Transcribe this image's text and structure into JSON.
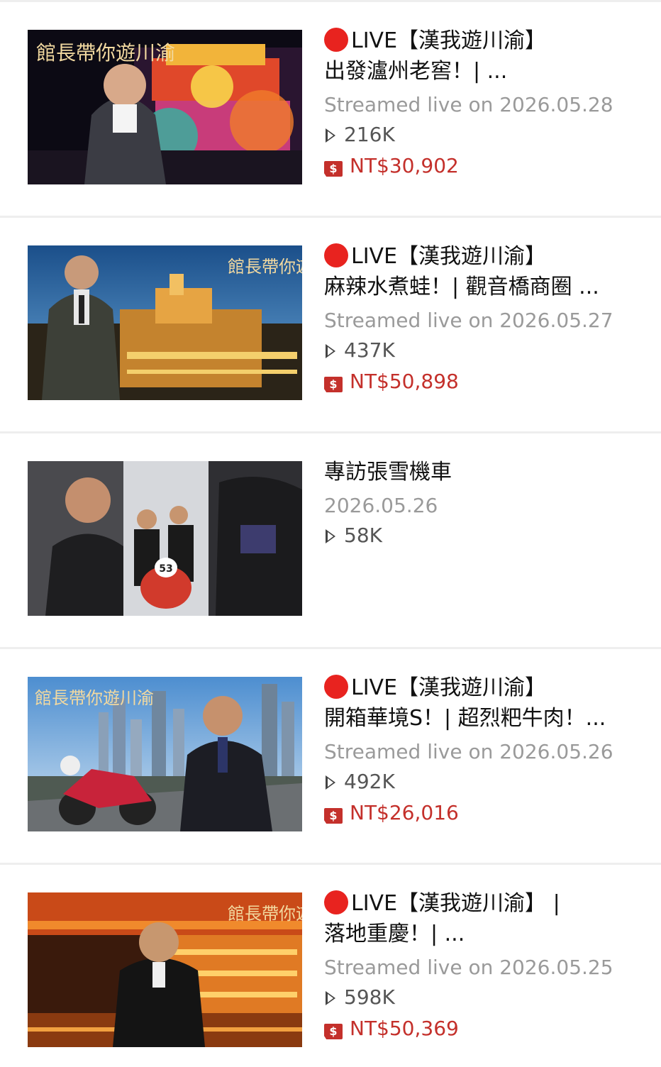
{
  "videos": [
    {
      "live_prefix": "LIVE",
      "title_line1": "【漢我遊川渝】",
      "title_line2": "出發瀘州老窖！| ...",
      "date": "Streamed live on 2026.05.28",
      "views": "216K",
      "price": "NT$30,902",
      "thumbnail_caption": "館長帶你遊川渝"
    },
    {
      "live_prefix": "LIVE",
      "title_line1": "【漢我遊川渝】",
      "title_line2": "麻辣水煮蛙！| 觀音橋商圈 ...",
      "date": "Streamed live on 2026.05.27",
      "views": "437K",
      "price": "NT$50,898",
      "thumbnail_caption": "館長帶你遊川渝"
    },
    {
      "live_prefix": "",
      "title_line1": "專訪張雪機車",
      "title_line2": "",
      "date": "2026.05.26",
      "views": "58K",
      "price": "",
      "thumbnail_caption": ""
    },
    {
      "live_prefix": "LIVE",
      "title_line1": "【漢我遊川渝】",
      "title_line2": "開箱華境S！| 超烈粑牛肉！...",
      "date": "Streamed live on 2026.05.26",
      "views": "492K",
      "price": "NT$26,016",
      "thumbnail_caption": "館長帶你遊川渝"
    },
    {
      "live_prefix": "LIVE",
      "title_line1": "【漢我遊川渝】 |",
      "title_line2": "落地重慶！| ...",
      "date": "Streamed live on 2026.05.25",
      "views": "598K",
      "price": "NT$50,369",
      "thumbnail_caption": "館長帶你遊川渝"
    }
  ],
  "icons": {
    "live": "red-circle-icon",
    "views": "play-icon",
    "price": "super-chat-dollar-icon"
  },
  "colors": {
    "live_dot": "#e8231f",
    "price": "#c4302b",
    "date": "#9a9a9a"
  },
  "thumb_badge_number": "53"
}
